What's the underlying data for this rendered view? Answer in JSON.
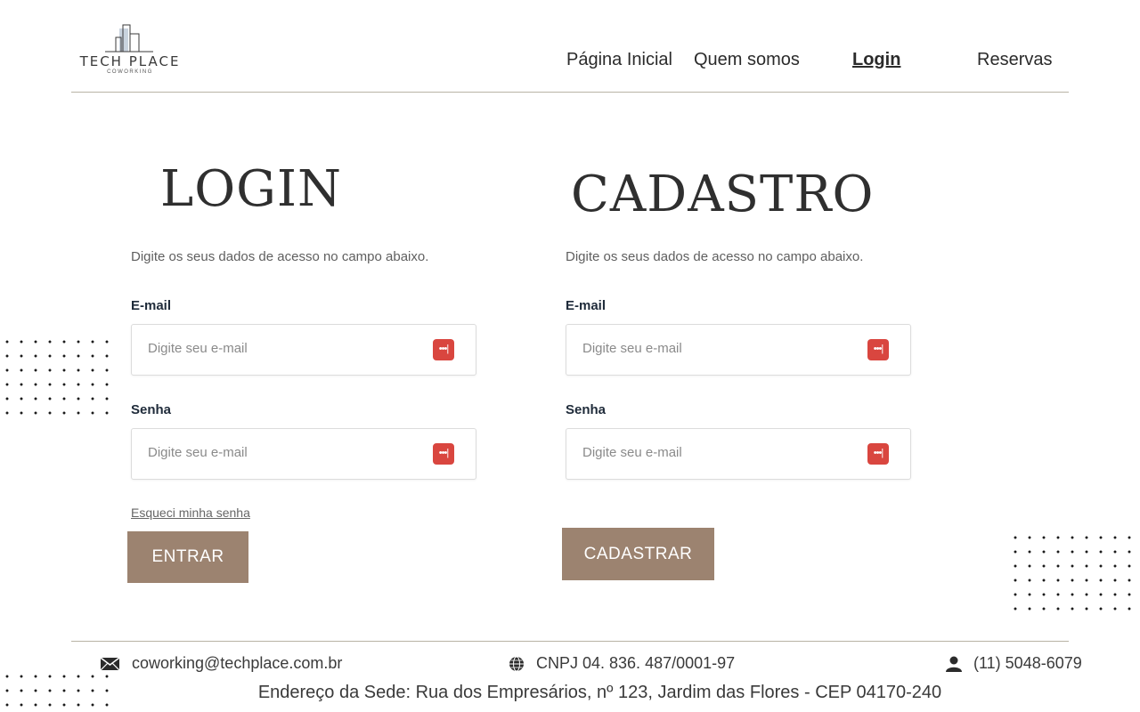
{
  "brand": {
    "name": "TECH PLACE",
    "sub": "COWORKING"
  },
  "nav": {
    "home": "Página Inicial",
    "about": "Quem somos",
    "login": "Login",
    "reservations": "Reservas"
  },
  "login": {
    "title": "LOGIN",
    "description": "Digite os seus dados de acesso no campo abaixo.",
    "email_label": "E-mail",
    "email_placeholder": "Digite seu e-mail",
    "password_label": "Senha",
    "password_placeholder": "Digite seu e-mail",
    "forgot": "Esqueci minha senha",
    "submit": "ENTRAR"
  },
  "signup": {
    "title": "CADASTRO",
    "description": "Digite os seus dados de acesso no campo abaixo.",
    "email_label": "E-mail",
    "email_placeholder": "Digite seu e-mail",
    "password_label": "Senha",
    "password_placeholder": "Digite seu e-mail",
    "submit": "CADASTRAR"
  },
  "footer": {
    "email": "coworking@techplace.com.br",
    "cnpj": "CNPJ 04. 836. 487/0001-97",
    "phone": "(11) 5048-6079",
    "address": "Endereço da Sede: Rua dos Empresários, nº 123, Jardim das Flores - CEP 04170-240"
  },
  "colors": {
    "accent": "#9c8370",
    "rule": "#b8b3a5",
    "badge": "#d9463f"
  }
}
